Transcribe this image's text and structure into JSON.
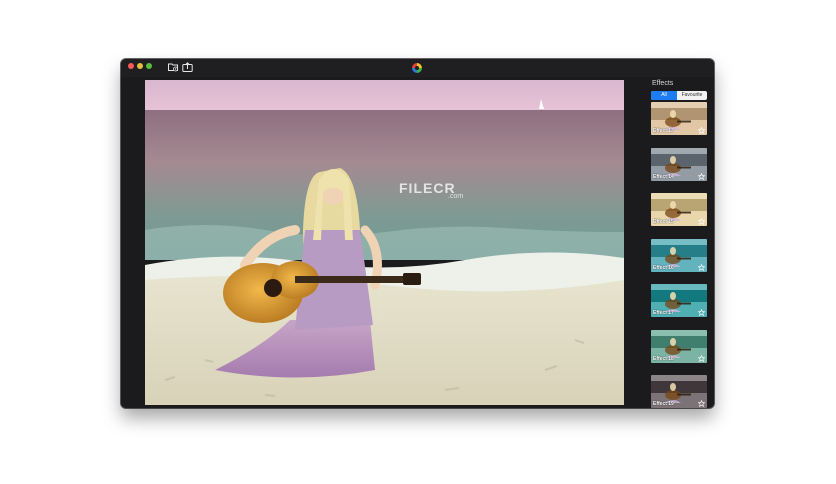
{
  "sidebar": {
    "title": "Effects",
    "filters": {
      "all": "All",
      "favourite": "Favourite"
    },
    "items": [
      {
        "label": "Effect 13",
        "tint": "#d8b58a"
      },
      {
        "label": "Effect 14",
        "tint": "#6f7b86"
      },
      {
        "label": "Effect 15",
        "tint": "#e2c98e"
      },
      {
        "label": "Effect 16",
        "tint": "#2f9aa8"
      },
      {
        "label": "Effect 17",
        "tint": "#16949a"
      },
      {
        "label": "Effect 18",
        "tint": "#4f9b86"
      },
      {
        "label": "Effect 19",
        "tint": "#4f4448"
      }
    ]
  },
  "watermark": {
    "brand": "FILECR",
    "domain": ".com"
  },
  "colors": {
    "accent": "#1e7cf2",
    "window_bg": "#1b1b1d",
    "close": "#fc5b57",
    "minimize": "#e5bf3c",
    "maximize": "#57c038"
  }
}
